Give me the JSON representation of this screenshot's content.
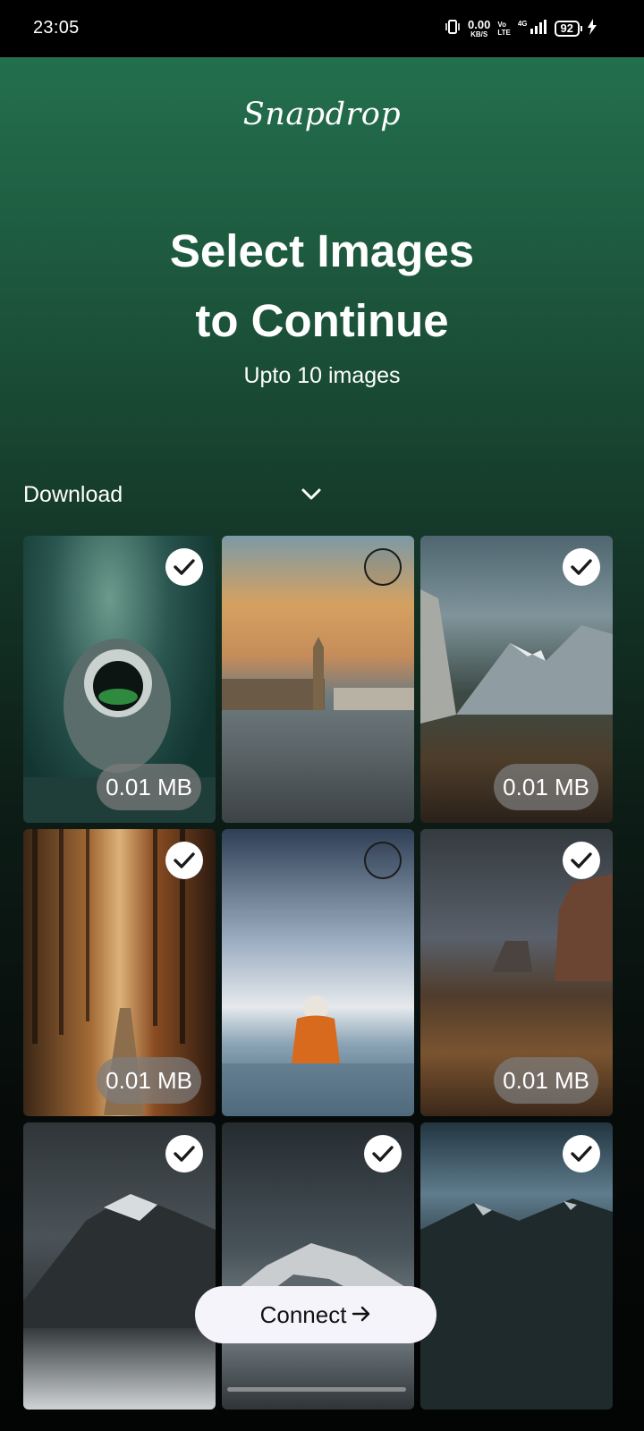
{
  "status_bar": {
    "time": "23:05",
    "speed_value": "0.00",
    "speed_unit": "KB/S",
    "volte_top": "Vo",
    "volte_bottom": "LTE",
    "network": "4G",
    "battery": "92"
  },
  "app": {
    "logo": "Snapdrop",
    "title_line1": "Select Images",
    "title_line2": "to Continue",
    "subtitle": "Upto 10 images",
    "folder_dropdown": {
      "label": "Download",
      "icon": "chevron-down-icon"
    },
    "connect_label": "Connect",
    "connect_icon": "arrow-right-icon"
  },
  "images": [
    {
      "subject": "astronaut",
      "selected": true,
      "size": "0.01 MB"
    },
    {
      "subject": "london",
      "selected": false,
      "size": ""
    },
    {
      "subject": "mountain-valley",
      "selected": true,
      "size": "0.01 MB"
    },
    {
      "subject": "forest-path",
      "selected": true,
      "size": "0.01 MB"
    },
    {
      "subject": "figure-in-water",
      "selected": false,
      "size": ""
    },
    {
      "subject": "desert-butte",
      "selected": true,
      "size": "0.01 MB"
    },
    {
      "subject": "snowy-peaks",
      "selected": true,
      "size": ""
    },
    {
      "subject": "misty-mountain",
      "selected": true,
      "size": ""
    },
    {
      "subject": "dark-valley",
      "selected": true,
      "size": ""
    }
  ],
  "colors": {
    "gradient_top": "#23704d",
    "gradient_bottom": "#030404",
    "size_badge": "#7d7d7d",
    "connect_button_bg": "#f6f4fb"
  }
}
